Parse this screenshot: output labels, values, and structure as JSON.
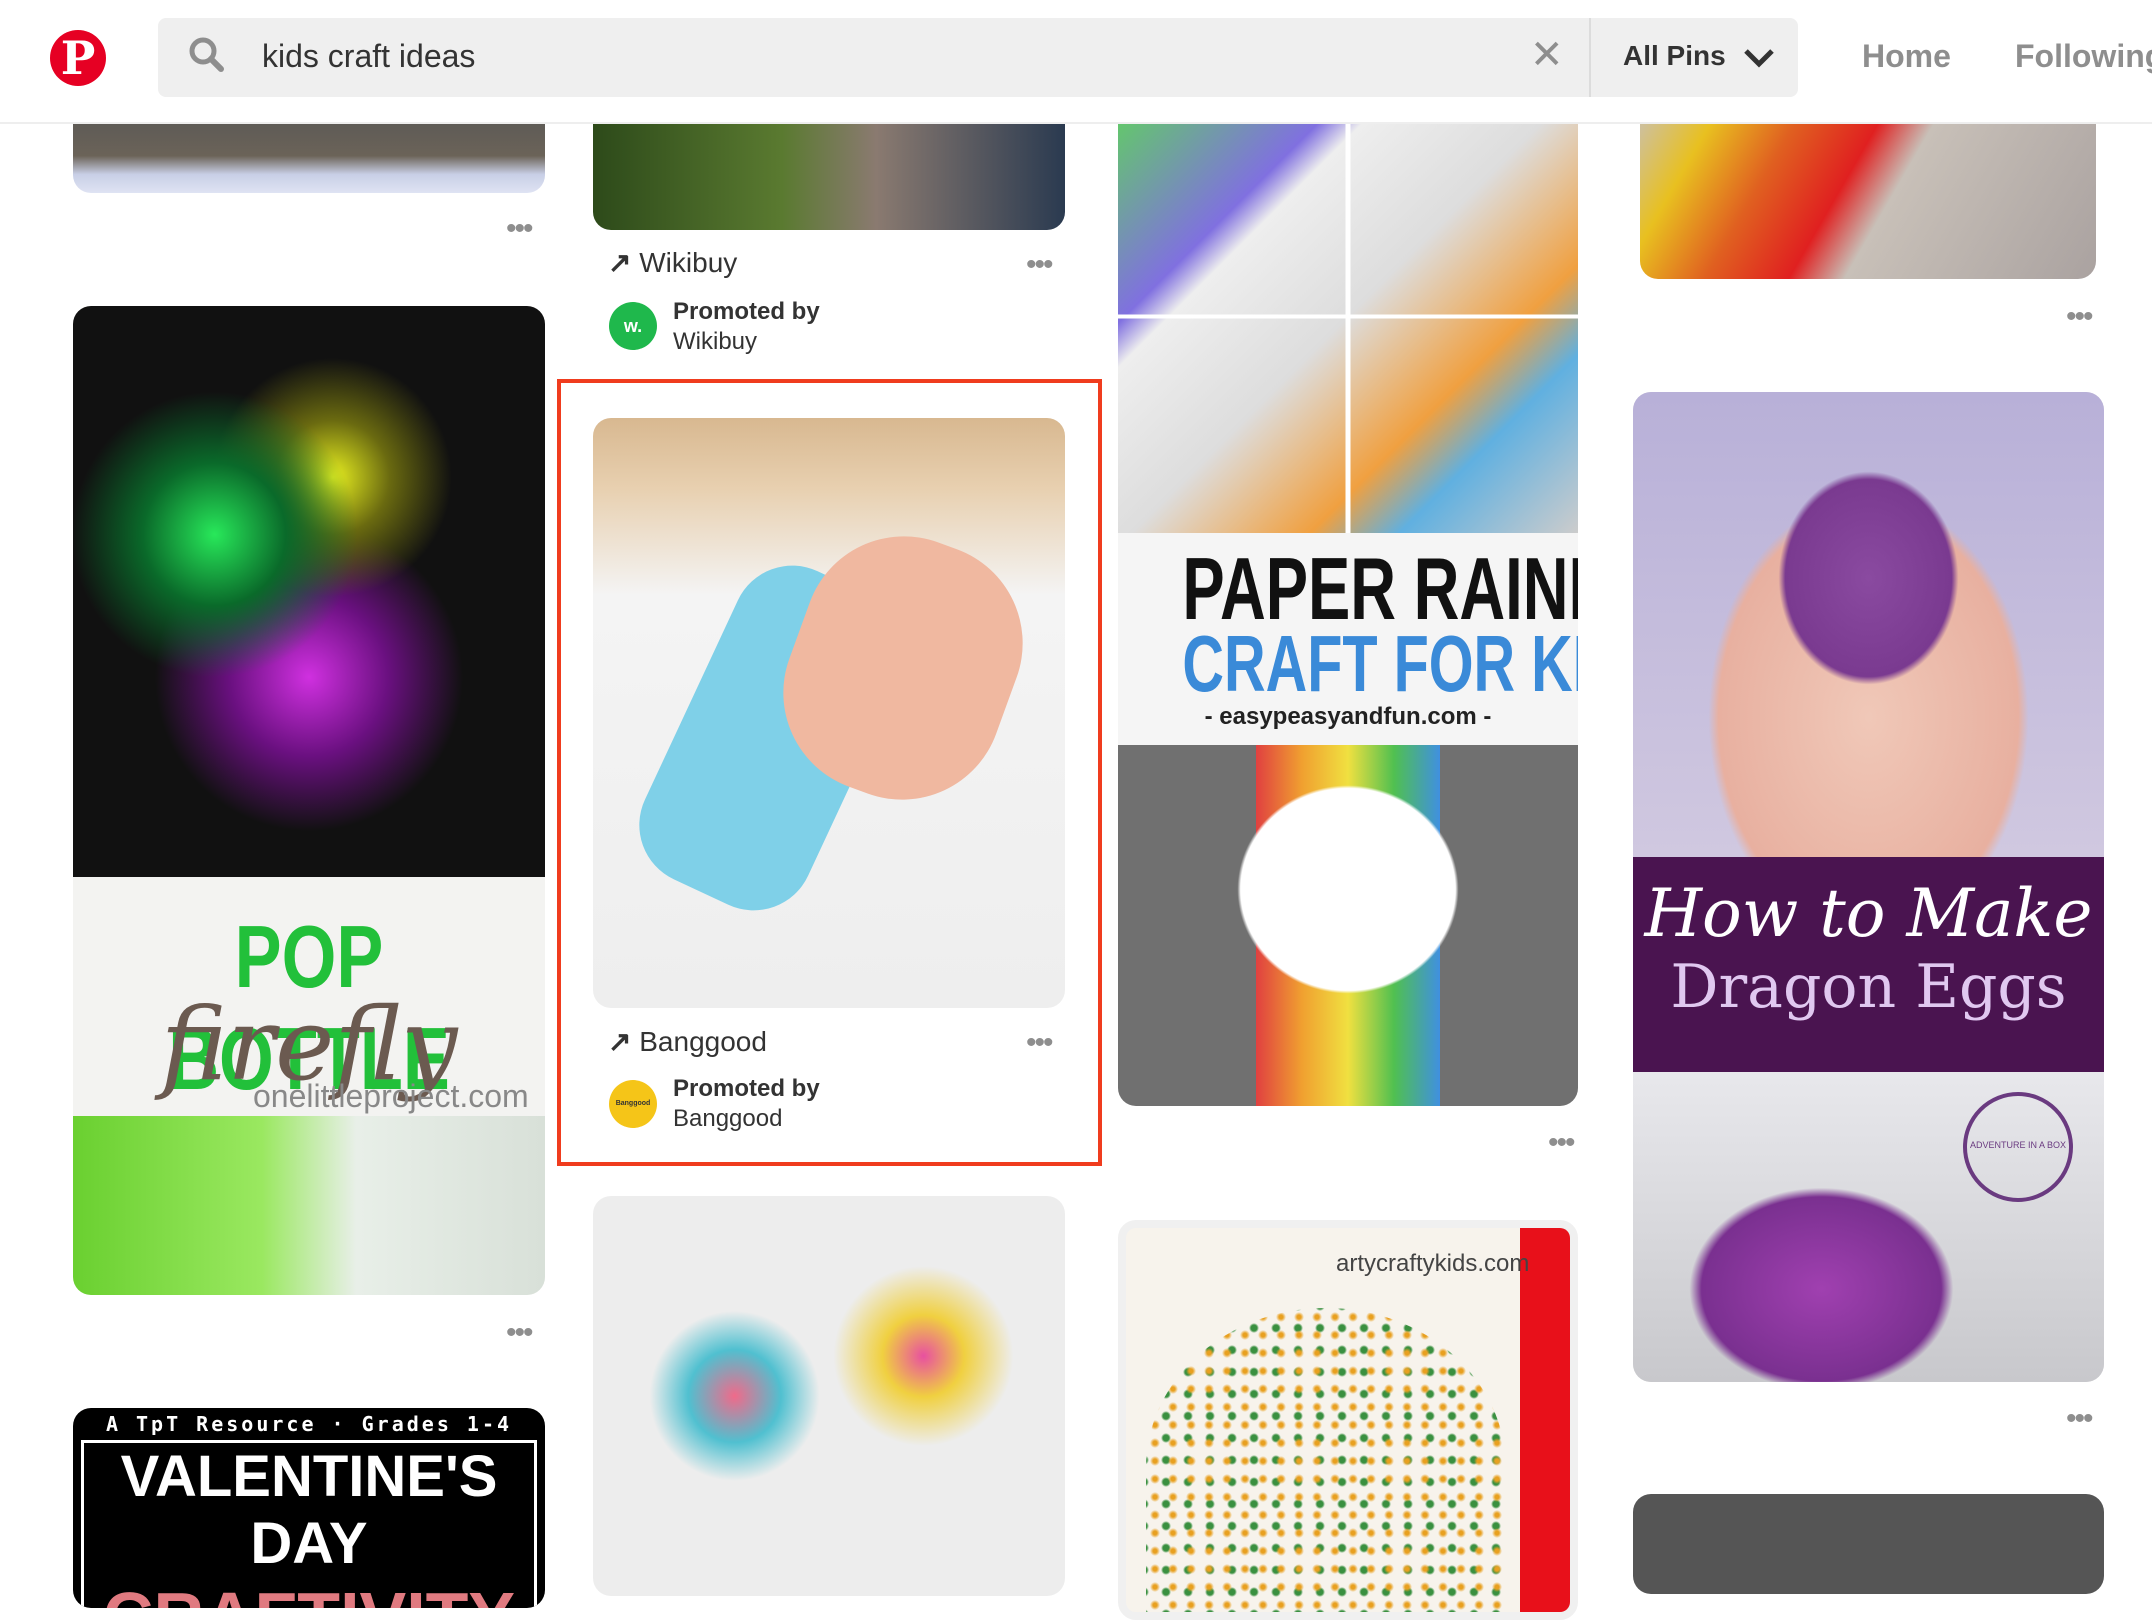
{
  "header": {
    "logo": "P",
    "search_query": "kids craft ideas",
    "search_icon": "search-icon",
    "clear_icon": "close-icon",
    "filter_label": "All Pins",
    "nav": [
      "Home",
      "Following"
    ]
  },
  "pins": {
    "wikibuy": {
      "source": "Wikibuy",
      "promoted_by": "Promoted by",
      "advertiser": "Wikibuy",
      "avatar": "w.",
      "avatar_color": "#1fb84c"
    },
    "banggood": {
      "source": "Banggood",
      "promoted_by": "Promoted by",
      "advertiser": "Banggood",
      "avatar": "Banggood",
      "avatar_color": "#f5c518"
    },
    "firefly": {
      "line1": "POP BOTTLE",
      "line2": "firefly",
      "url": "onelittleproject.com"
    },
    "rainbow": {
      "line1": "PAPER RAINBOW",
      "line2": "CRAFT FOR KIDS",
      "url": "- easypeasyandfun.com -"
    },
    "dragon": {
      "line1": "How to Make",
      "line2": "Dragon Eggs",
      "badge": "ADVENTURE IN A BOX"
    },
    "valentine": {
      "top": "A TpT Resource · Grades 1-4",
      "line1": "VALENTINE'S DAY",
      "line2": "CRAFTIVITY"
    },
    "arty": {
      "url": "artycraftykids.com"
    },
    "more_label": "•••"
  },
  "colors": {
    "brand": "#e60023",
    "highlight": "#f03c1e"
  }
}
